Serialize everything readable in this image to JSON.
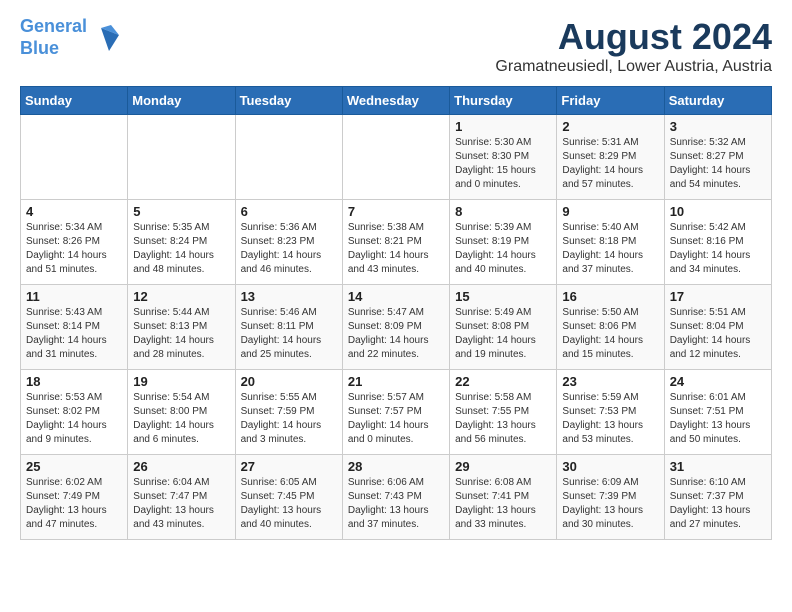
{
  "header": {
    "logo_line1": "General",
    "logo_line2": "Blue",
    "title": "August 2024",
    "subtitle": "Gramatneusiedl, Lower Austria, Austria"
  },
  "weekdays": [
    "Sunday",
    "Monday",
    "Tuesday",
    "Wednesday",
    "Thursday",
    "Friday",
    "Saturday"
  ],
  "weeks": [
    [
      {
        "day": "",
        "info": ""
      },
      {
        "day": "",
        "info": ""
      },
      {
        "day": "",
        "info": ""
      },
      {
        "day": "",
        "info": ""
      },
      {
        "day": "1",
        "info": "Sunrise: 5:30 AM\nSunset: 8:30 PM\nDaylight: 15 hours\nand 0 minutes."
      },
      {
        "day": "2",
        "info": "Sunrise: 5:31 AM\nSunset: 8:29 PM\nDaylight: 14 hours\nand 57 minutes."
      },
      {
        "day": "3",
        "info": "Sunrise: 5:32 AM\nSunset: 8:27 PM\nDaylight: 14 hours\nand 54 minutes."
      }
    ],
    [
      {
        "day": "4",
        "info": "Sunrise: 5:34 AM\nSunset: 8:26 PM\nDaylight: 14 hours\nand 51 minutes."
      },
      {
        "day": "5",
        "info": "Sunrise: 5:35 AM\nSunset: 8:24 PM\nDaylight: 14 hours\nand 48 minutes."
      },
      {
        "day": "6",
        "info": "Sunrise: 5:36 AM\nSunset: 8:23 PM\nDaylight: 14 hours\nand 46 minutes."
      },
      {
        "day": "7",
        "info": "Sunrise: 5:38 AM\nSunset: 8:21 PM\nDaylight: 14 hours\nand 43 minutes."
      },
      {
        "day": "8",
        "info": "Sunrise: 5:39 AM\nSunset: 8:19 PM\nDaylight: 14 hours\nand 40 minutes."
      },
      {
        "day": "9",
        "info": "Sunrise: 5:40 AM\nSunset: 8:18 PM\nDaylight: 14 hours\nand 37 minutes."
      },
      {
        "day": "10",
        "info": "Sunrise: 5:42 AM\nSunset: 8:16 PM\nDaylight: 14 hours\nand 34 minutes."
      }
    ],
    [
      {
        "day": "11",
        "info": "Sunrise: 5:43 AM\nSunset: 8:14 PM\nDaylight: 14 hours\nand 31 minutes."
      },
      {
        "day": "12",
        "info": "Sunrise: 5:44 AM\nSunset: 8:13 PM\nDaylight: 14 hours\nand 28 minutes."
      },
      {
        "day": "13",
        "info": "Sunrise: 5:46 AM\nSunset: 8:11 PM\nDaylight: 14 hours\nand 25 minutes."
      },
      {
        "day": "14",
        "info": "Sunrise: 5:47 AM\nSunset: 8:09 PM\nDaylight: 14 hours\nand 22 minutes."
      },
      {
        "day": "15",
        "info": "Sunrise: 5:49 AM\nSunset: 8:08 PM\nDaylight: 14 hours\nand 19 minutes."
      },
      {
        "day": "16",
        "info": "Sunrise: 5:50 AM\nSunset: 8:06 PM\nDaylight: 14 hours\nand 15 minutes."
      },
      {
        "day": "17",
        "info": "Sunrise: 5:51 AM\nSunset: 8:04 PM\nDaylight: 14 hours\nand 12 minutes."
      }
    ],
    [
      {
        "day": "18",
        "info": "Sunrise: 5:53 AM\nSunset: 8:02 PM\nDaylight: 14 hours\nand 9 minutes."
      },
      {
        "day": "19",
        "info": "Sunrise: 5:54 AM\nSunset: 8:00 PM\nDaylight: 14 hours\nand 6 minutes."
      },
      {
        "day": "20",
        "info": "Sunrise: 5:55 AM\nSunset: 7:59 PM\nDaylight: 14 hours\nand 3 minutes."
      },
      {
        "day": "21",
        "info": "Sunrise: 5:57 AM\nSunset: 7:57 PM\nDaylight: 14 hours\nand 0 minutes."
      },
      {
        "day": "22",
        "info": "Sunrise: 5:58 AM\nSunset: 7:55 PM\nDaylight: 13 hours\nand 56 minutes."
      },
      {
        "day": "23",
        "info": "Sunrise: 5:59 AM\nSunset: 7:53 PM\nDaylight: 13 hours\nand 53 minutes."
      },
      {
        "day": "24",
        "info": "Sunrise: 6:01 AM\nSunset: 7:51 PM\nDaylight: 13 hours\nand 50 minutes."
      }
    ],
    [
      {
        "day": "25",
        "info": "Sunrise: 6:02 AM\nSunset: 7:49 PM\nDaylight: 13 hours\nand 47 minutes."
      },
      {
        "day": "26",
        "info": "Sunrise: 6:04 AM\nSunset: 7:47 PM\nDaylight: 13 hours\nand 43 minutes."
      },
      {
        "day": "27",
        "info": "Sunrise: 6:05 AM\nSunset: 7:45 PM\nDaylight: 13 hours\nand 40 minutes."
      },
      {
        "day": "28",
        "info": "Sunrise: 6:06 AM\nSunset: 7:43 PM\nDaylight: 13 hours\nand 37 minutes."
      },
      {
        "day": "29",
        "info": "Sunrise: 6:08 AM\nSunset: 7:41 PM\nDaylight: 13 hours\nand 33 minutes."
      },
      {
        "day": "30",
        "info": "Sunrise: 6:09 AM\nSunset: 7:39 PM\nDaylight: 13 hours\nand 30 minutes."
      },
      {
        "day": "31",
        "info": "Sunrise: 6:10 AM\nSunset: 7:37 PM\nDaylight: 13 hours\nand 27 minutes."
      }
    ]
  ]
}
